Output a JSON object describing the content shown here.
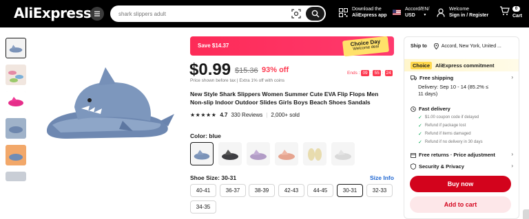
{
  "header": {
    "logo": "AliExpress",
    "search_placeholder": "shark slippers adult",
    "app_line1": "Download the",
    "app_line2": "AliExpress app",
    "lang_line1": "Accord/EN/",
    "lang_line2": "USD",
    "acct_line1": "Welcome",
    "acct_line2": "Sign in / Register",
    "cart_count": "0",
    "cart_label": "Cart"
  },
  "banner": {
    "save_text": "Save $14.37",
    "choice_line1": "Choice Day",
    "choice_line2": "Welcome deal"
  },
  "price": {
    "current": "$0.99",
    "original": "$15.36",
    "discount": "93% off",
    "ends_label": "Ends :",
    "ends_h": "09",
    "ends_m": "55",
    "ends_s": "24",
    "note": "Price shown before tax | Extra 1% off with coins"
  },
  "product": {
    "title": "New Style Shark Slippers Women Summer Cute EVA Flip Flops Men Non-slip Indoor Outdoor Slides Girls Boys Beach Shoes Sandals",
    "stars": "★★★★★",
    "rating": "4.7",
    "reviews": "330 Reviews",
    "sold": "2,000+ sold",
    "color_label": "Color: blue",
    "size_label": "Shoe Size: 30-31",
    "size_info": "Size Info",
    "sizes": [
      "40-41",
      "36-37",
      "38-39",
      "42-43",
      "44-45",
      "30-31",
      "32-33",
      "34-35"
    ],
    "swatch_colors": [
      "#7b93b8",
      "#3e3e42",
      "#b29cc6",
      "#e6a48f",
      "#e8dcae",
      "#d9d9d9"
    ]
  },
  "panel": {
    "ship_to_label": "Ship to",
    "ship_to_value": "Accord, New York, United ...",
    "choice_pill": "Choice",
    "commitment": "AliExpress commitment",
    "free_shipping": "Free shipping",
    "delivery_line1": "Delivery: Sep 10 - 14 (85.2% ≤",
    "delivery_line2": "11 days)",
    "fast_delivery": "Fast delivery",
    "checks": [
      "$1.00 coupon code if delayed",
      "Refund if package lost",
      "Refund if items damaged",
      "Refund if no delivery in 30 days"
    ],
    "free_returns": "Free returns · Price adjustment",
    "security": "Security & Privacy",
    "buy_now": "Buy now",
    "add_to_cart": "Add to cart"
  }
}
